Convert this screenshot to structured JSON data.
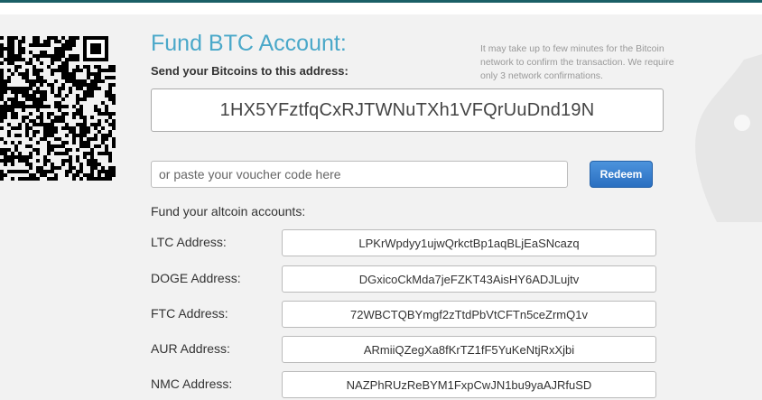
{
  "fund": {
    "title": "Fund BTC Account:",
    "subtitle": "Send your Bitcoins to this address:",
    "note": "It may take up to few minutes for the Bitcoin network to confirm the transaction. We require only 3 network confirmations.",
    "btc_address": "1HX5YFztfqCxRJTWNuTXh1VFQrUuDnd19N",
    "voucher_placeholder": "or paste your voucher code here",
    "redeem_label": "Redeem"
  },
  "altcoins": {
    "heading": "Fund your altcoin accounts:",
    "rows": [
      {
        "label": "LTC Address:",
        "address": "LPKrWpdyy1ujwQrkctBp1aqBLjEaSNcazq"
      },
      {
        "label": "DOGE Address:",
        "address": "DGxicoCkMda7jeFZKT43AisHY6ADJLujtv"
      },
      {
        "label": "FTC Address:",
        "address": "72WBCTQBYmgf2zTtdPbVtCFTn5ceZrmQ1v"
      },
      {
        "label": "AUR Address:",
        "address": "ARmiiQZegXa8fKrTZ1fF5YuKeNtjRxXjbi"
      },
      {
        "label": "NMC Address:",
        "address": "NAZPhRUzReBYM1FxpCwJN1bu9yaAJRfuSD"
      }
    ]
  },
  "icons": {
    "qr": "qr-code-icon",
    "mascot": "mascot-icon"
  },
  "colors": {
    "accent": "#1a5f66",
    "title": "#4aa8c9",
    "button": "#2a6fc1"
  }
}
